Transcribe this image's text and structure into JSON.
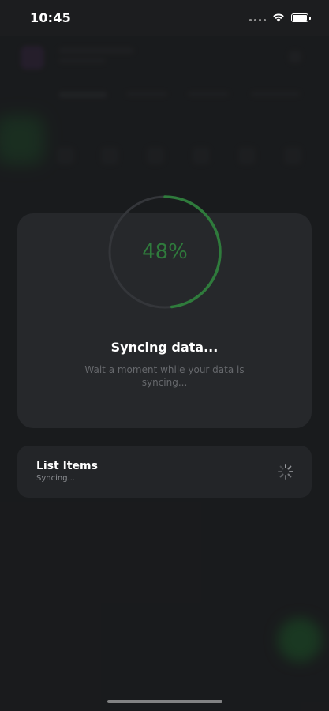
{
  "status_bar": {
    "time": "10:45"
  },
  "sync": {
    "progress": 0.48,
    "percent_label": "48%",
    "title": "Syncing data...",
    "description": "Wait a moment while your data is syncing..."
  },
  "list_item": {
    "title": "List Items",
    "subtitle": "Syncing..."
  },
  "colors": {
    "accent_green": "#2f7b3c",
    "background": "#1c1d1f",
    "card": "#26282b"
  }
}
